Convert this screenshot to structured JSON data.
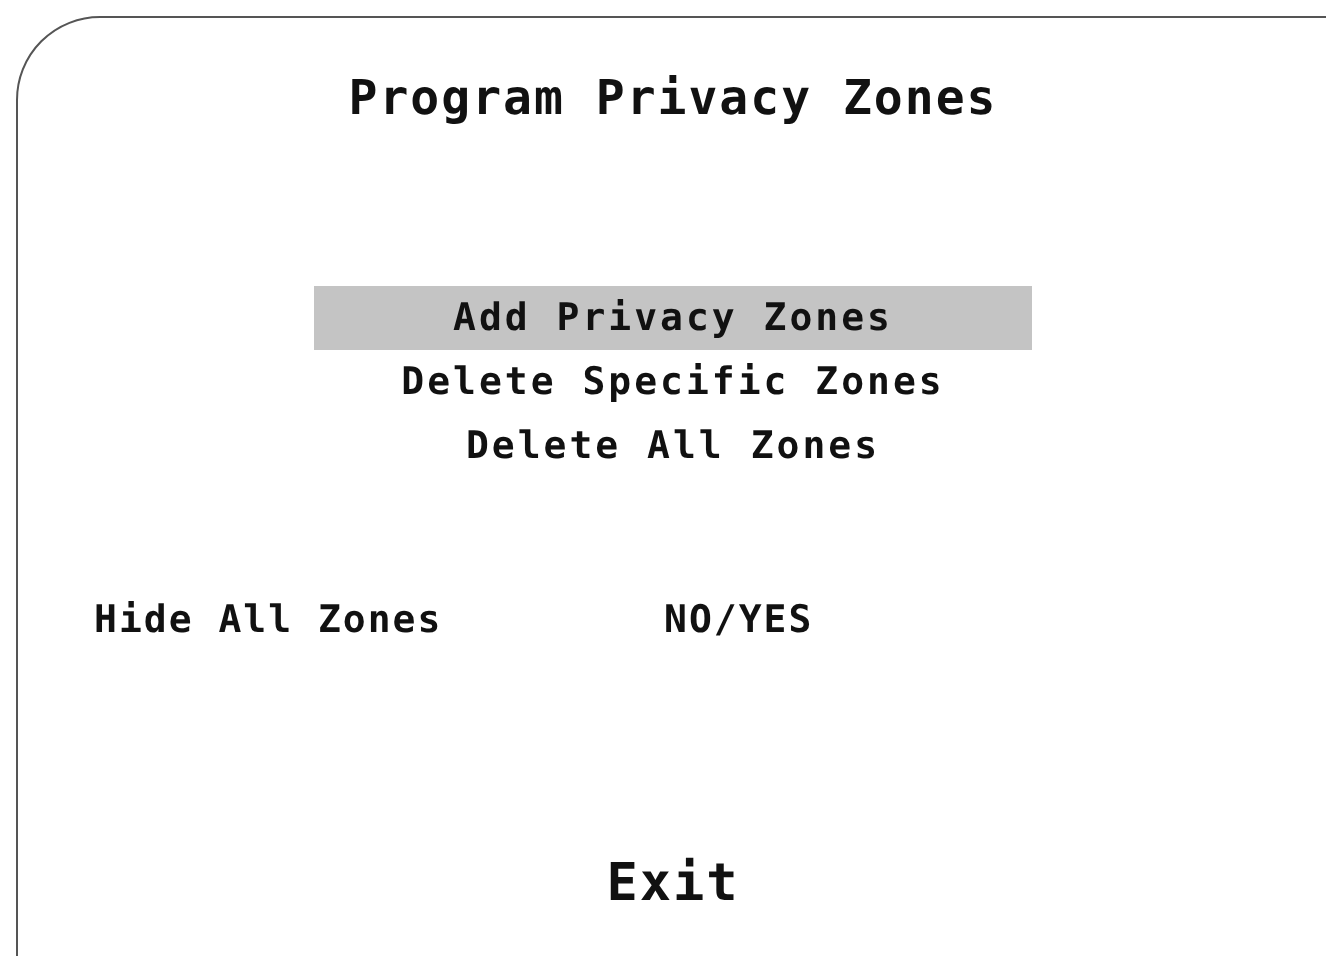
{
  "title": "Program Privacy Zones",
  "menu_items": [
    {
      "label": "Add Privacy Zones",
      "selected": true
    },
    {
      "label": "Delete Specific Zones",
      "selected": false
    },
    {
      "label": "Delete All Zones",
      "selected": false
    }
  ],
  "hide_all_zones": {
    "label": "Hide All Zones",
    "value": "NO/YES"
  },
  "exit_button": "Exit"
}
